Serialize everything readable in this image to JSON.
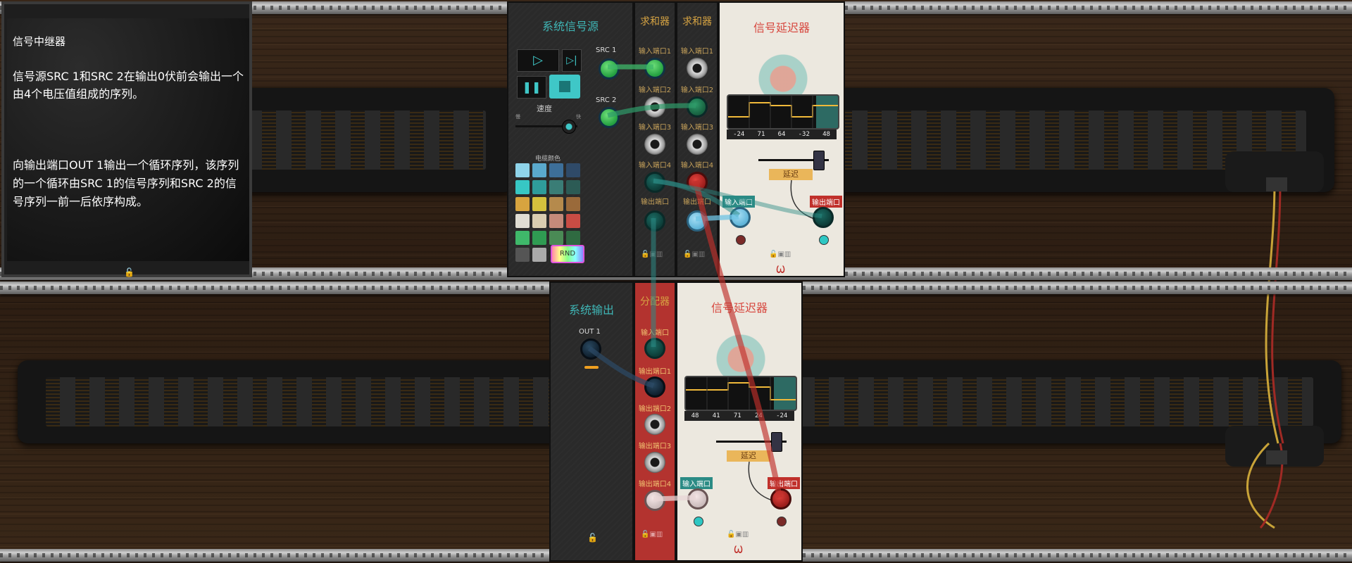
{
  "info_panel": {
    "title": "信号中继器",
    "para1": "信号源SRC 1和SRC 2在输出0伏前会输出一个由4个电压值组成的序列。",
    "para2": " 向输出端口OUT 1输出一个循环序列，该序列的一个循环由SRC 1的信号序列和SRC 2的信号序列一前一后依序构成。"
  },
  "source_module": {
    "title": "系统信号源",
    "speed_label": "速度",
    "speed_slow": "慢",
    "speed_fast": "快",
    "speed_value": 0.85,
    "cable_color_label": "电缆颜色",
    "rnd_label": "RND",
    "src1": "SRC 1",
    "src2": "SRC 2",
    "colors": [
      "#8fd4ea",
      "#5aa9cc",
      "#3d6f99",
      "#2f4a68",
      "#37c7c4",
      "#2f9c9b",
      "#3a7d76",
      "#2c5b55",
      "#d7a43f",
      "#d5c13d",
      "#b58a4c",
      "#9a6a3a",
      "#e0ddd3",
      "#d9cdb0",
      "#c48a7a",
      "#c84c44",
      "#3fb86a",
      "#2f9b52",
      "#4a8a55",
      "#2f6a41",
      "#555",
      "#aaa"
    ]
  },
  "adder1": {
    "title": "求和器",
    "in1": "输入端口1",
    "in2": "输入端口2",
    "in3": "输入端口3",
    "in4": "输入端口4",
    "out": "输出端口"
  },
  "adder2": {
    "title": "求和器",
    "in1": "输入端口1",
    "in2": "输入端口2",
    "in3": "输入端口3",
    "in4": "输入端口4",
    "out": "输出端口"
  },
  "delay1": {
    "title": "信号延迟器",
    "readouts": [
      "-24",
      "71",
      "64",
      "-32",
      "48"
    ],
    "delay_label": "延迟",
    "delay_value": 0.85,
    "in_label": "输入端口",
    "out_label": "输出端口"
  },
  "output_module": {
    "title": "系统输出",
    "out1": "OUT 1"
  },
  "splitter": {
    "title": "分配器",
    "in": "输入端口",
    "out1": "输出端口1",
    "out2": "输出端口2",
    "out3": "输出端口3",
    "out4": "输出端口4"
  },
  "delay2": {
    "title": "信号延迟器",
    "readouts": [
      "48",
      "41",
      "71",
      "24",
      "-24"
    ],
    "delay_label": "延迟",
    "delay_value": 0.85,
    "in_label": "输入端口",
    "out_label": "输出端口"
  }
}
